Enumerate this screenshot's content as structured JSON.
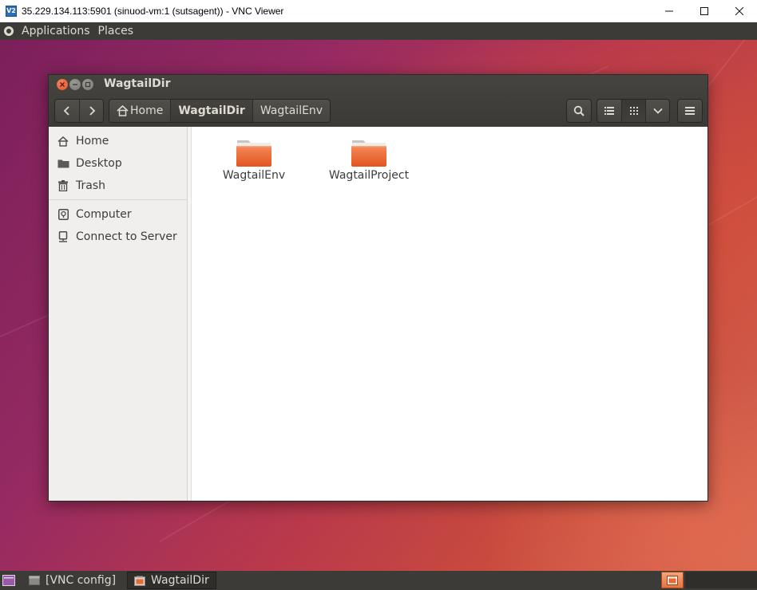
{
  "vnc": {
    "title": "35.229.134.113:5901 (sinuod-vm:1 (sutsagent)) - VNC Viewer",
    "app_icon_text": "V2",
    "controls": [
      "minimize",
      "maximize",
      "close"
    ]
  },
  "panel": {
    "menus": [
      "Applications",
      "Places"
    ]
  },
  "window": {
    "title": "WagtailDir",
    "breadcrumbs": [
      "Home",
      "WagtailDir",
      "WagtailEnv"
    ],
    "active_crumb": "WagtailDir",
    "toolbar_icons": [
      "search-icon",
      "list-view-icon",
      "grid-view-icon",
      "view-options-icon",
      "menu-icon"
    ]
  },
  "sidebar": {
    "places": [
      {
        "label": "Home",
        "icon": "home-icon"
      },
      {
        "label": "Desktop",
        "icon": "folder-icon"
      },
      {
        "label": "Trash",
        "icon": "trash-icon"
      }
    ],
    "devices": [
      {
        "label": "Computer",
        "icon": "computer-icon"
      },
      {
        "label": "Connect to Server",
        "icon": "network-server-icon"
      }
    ]
  },
  "files": [
    {
      "name": "WagtailEnv",
      "icon": "folder-icon"
    },
    {
      "name": "WagtailProject",
      "icon": "folder-icon"
    }
  ],
  "taskbar": {
    "tasks": [
      {
        "label": "[VNC config]",
        "icon": "window-icon"
      },
      {
        "label": "WagtailDir",
        "icon": "file-manager-icon"
      }
    ]
  },
  "colors": {
    "panel": "#3c3b37",
    "header": "#3b3a36",
    "folder_orange": "#e8602c",
    "close_button": "#e0532c"
  }
}
